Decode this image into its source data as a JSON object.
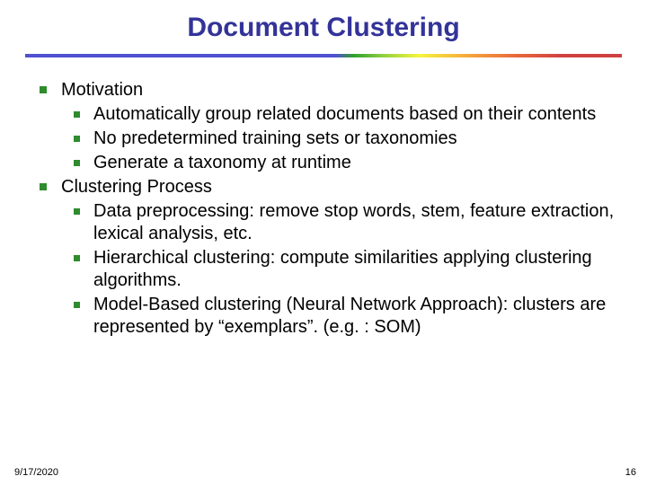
{
  "title": "Document Clustering",
  "bullets": {
    "b1": {
      "label": "Motivation",
      "s1": "Automatically group related documents based on their contents",
      "s2": "No predetermined training sets or taxonomies",
      "s3": "Generate a taxonomy at runtime"
    },
    "b2": {
      "label": "Clustering Process",
      "s1": "Data preprocessing: remove stop words, stem, feature extraction, lexical analysis, etc.",
      "s2": "Hierarchical clustering: compute similarities applying clustering algorithms.",
      "s3": "Model-Based clustering (Neural Network Approach): clusters are represented by “exemplars”. (e.g. : SOM)"
    }
  },
  "footer": {
    "date": "9/17/2020",
    "page": "16"
  }
}
